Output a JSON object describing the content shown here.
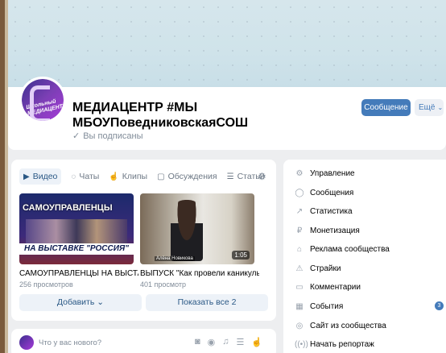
{
  "group": {
    "name_line1": "МЕДИАЦЕНТР #МЫ",
    "name_line2": "МБОУПоведниковскаяСОШ",
    "subscribed": "Вы подписаны",
    "avatar_text_line1": "Школьный",
    "avatar_text_line2": "МЕДИАЦЕНТР"
  },
  "actions": {
    "message": "Сообщение",
    "more": "Ещё"
  },
  "tabs": [
    {
      "label": "Видео",
      "icon": "video-icon"
    },
    {
      "label": "Чаты",
      "icon": "chat-icon"
    },
    {
      "label": "Клипы",
      "icon": "clip-icon"
    },
    {
      "label": "Обсуждения",
      "icon": "discussion-icon"
    },
    {
      "label": "Статьи",
      "icon": "article-icon"
    }
  ],
  "videos": [
    {
      "title": "САМОУПРАВЛЕНЦЫ НА ВЫСТАВК...",
      "views": "256 просмотров",
      "thumb_title": "САМОУПРАВЛЕНЦЫ",
      "thumb_banner": "НА ВЫСТАВКЕ \"РОССИЯ\""
    },
    {
      "title": "ВЫПУСК \"Как провели каникулы у...",
      "views": "401 просмотр",
      "duration": "1:05",
      "thumb_caption": "Алёна Новикова"
    }
  ],
  "buttons": {
    "add": "Добавить",
    "show_all": "Показать все 2"
  },
  "post": {
    "placeholder": "Что у вас нового?"
  },
  "sidebar": {
    "items": [
      {
        "label": "Управление",
        "icon": "gear-icon"
      },
      {
        "label": "Сообщения",
        "icon": "message-icon"
      },
      {
        "label": "Статистика",
        "icon": "stats-icon"
      },
      {
        "label": "Монетизация",
        "icon": "money-icon"
      },
      {
        "label": "Реклама сообщества",
        "icon": "ads-icon"
      },
      {
        "label": "Страйки",
        "icon": "warning-icon"
      },
      {
        "label": "Комментарии",
        "icon": "comment-icon"
      },
      {
        "label": "События",
        "icon": "calendar-icon",
        "badge": "3"
      },
      {
        "label": "Сайт из сообщества",
        "icon": "globe-icon"
      },
      {
        "label": "Начать репортаж",
        "icon": "broadcast-icon"
      }
    ]
  }
}
